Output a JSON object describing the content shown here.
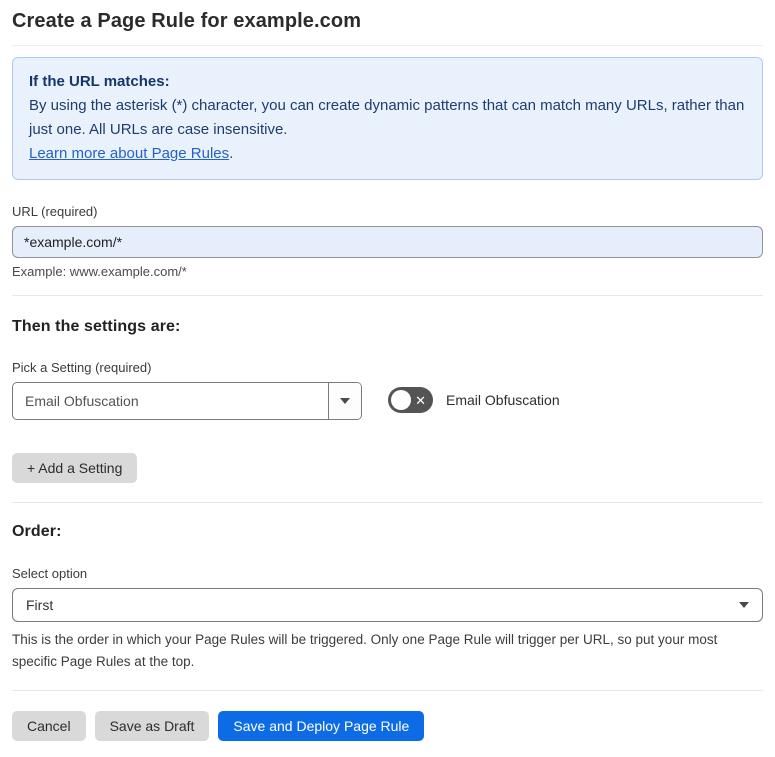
{
  "page": {
    "title": "Create a Page Rule for example.com"
  },
  "info_box": {
    "heading": "If the URL matches:",
    "body": "By using the asterisk (*) character, you can create dynamic patterns that can match many URLs, rather than just one. All URLs are case insensitive.",
    "link": "Learn more about Page Rules",
    "link_suffix": "."
  },
  "url_field": {
    "label": "URL (required)",
    "value": "*example.com/*",
    "hint": "Example: www.example.com/*"
  },
  "settings": {
    "heading": "Then the settings are:",
    "picker_label": "Pick a Setting (required)",
    "picker_value": "Email Obfuscation",
    "toggle_state": "off",
    "toggle_icon": "✕",
    "toggle_label": "Email Obfuscation",
    "add_button_label": "+ Add a Setting"
  },
  "order": {
    "heading": "Order:",
    "label": "Select option",
    "value": "First",
    "help": "This is the order in which your Page Rules will be triggered. Only one Page Rule will trigger per URL, so put your most specific Page Rules at the top."
  },
  "footer": {
    "cancel_label": "Cancel",
    "save_draft_label": "Save as Draft",
    "save_deploy_label": "Save and Deploy Page Rule"
  },
  "colors": {
    "accent_blue": "#0d6ce5",
    "info_box_bg": "#e9f2fc",
    "info_box_border": "#a9cdf2",
    "info_text": "#1d3d6e",
    "link_blue": "#2262c8",
    "url_input_bg": "#e6eefb",
    "gray_button_bg": "#d9d9d9",
    "toggle_off_bg": "#545454"
  }
}
